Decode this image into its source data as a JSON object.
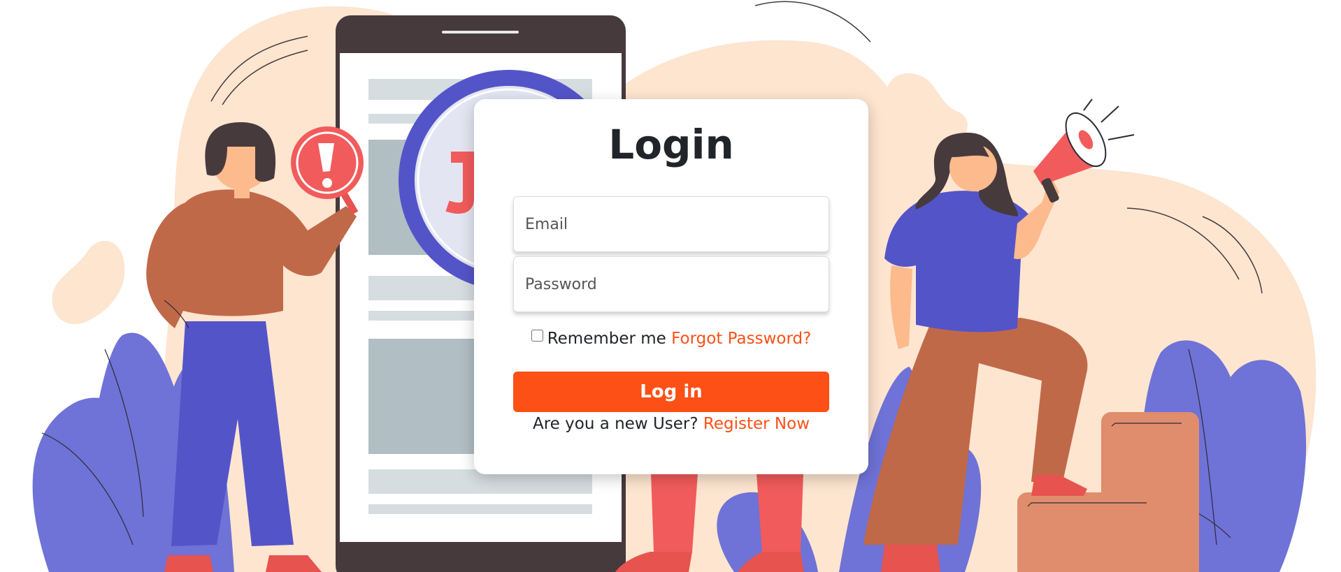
{
  "login": {
    "title": "Login",
    "email_placeholder": "Email",
    "password_placeholder": "Password",
    "remember_label": "Remember me",
    "forgot_link": "Forgot Password?",
    "submit_label": "Log in",
    "new_user_text": "Are you a new User?",
    "register_link": "Register Now"
  },
  "colors": {
    "accent": "#fc5016",
    "background_blob": "#fde5d0",
    "phone_frame": "#473a3d",
    "purple": "#5454c9",
    "leaf_purple": "#6f72d6",
    "brown": "#c06949",
    "coral": "#f25b5b"
  },
  "illustration": {
    "icons": [
      "warning-sign-icon",
      "megaphone-icon",
      "phone-icon"
    ]
  }
}
